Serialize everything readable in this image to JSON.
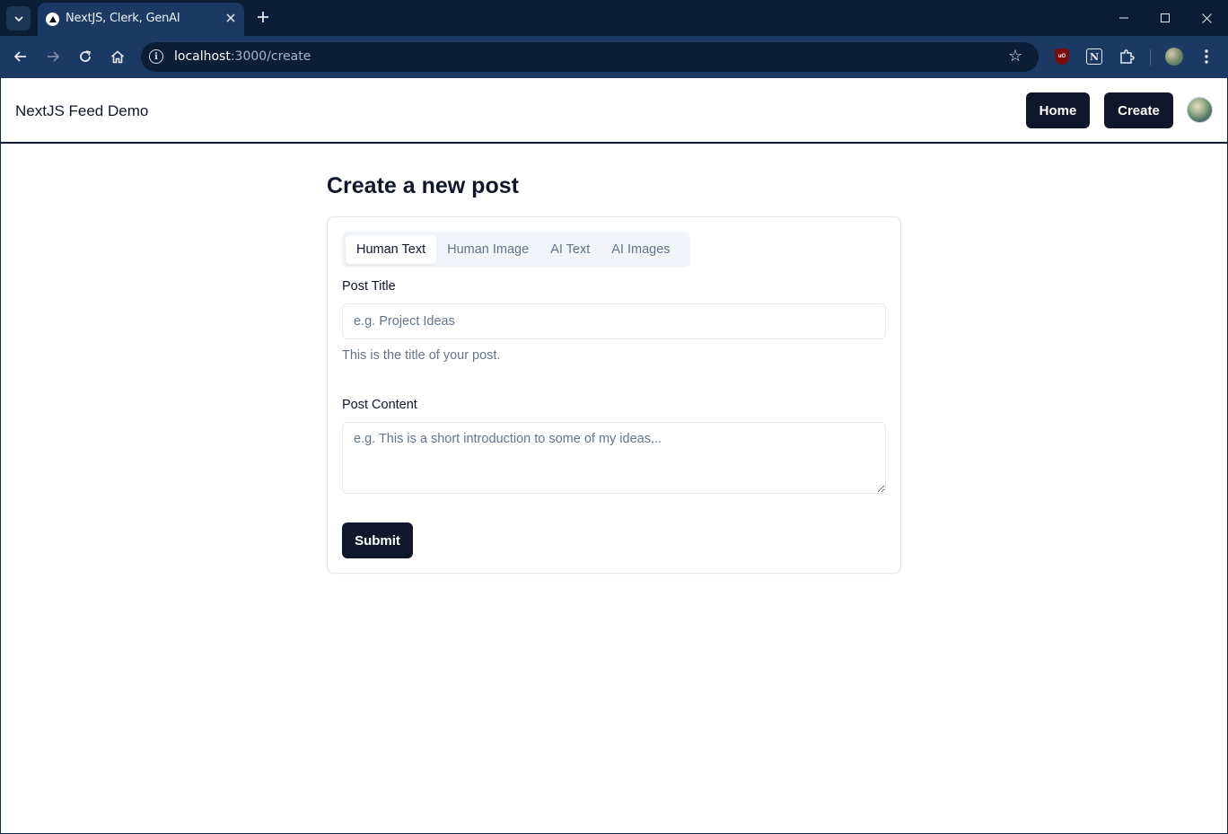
{
  "browser": {
    "tab_title": "NextJS, Clerk, GenAI",
    "url_host": "localhost",
    "url_path": ":3000/create",
    "ext_ublock_label": "uO"
  },
  "navbar": {
    "brand": "NextJS Feed Demo",
    "home_label": "Home",
    "create_label": "Create"
  },
  "main": {
    "heading": "Create a new post",
    "tabs": [
      {
        "label": "Human Text",
        "active": true
      },
      {
        "label": "Human Image",
        "active": false
      },
      {
        "label": "AI Text",
        "active": false
      },
      {
        "label": "AI Images",
        "active": false
      }
    ],
    "form": {
      "title_label": "Post Title",
      "title_placeholder": "e.g. Project Ideas",
      "title_value": "",
      "title_description": "This is the title of your post.",
      "content_label": "Post Content",
      "content_placeholder": "e.g. This is a short introduction to some of my ideas...",
      "content_value": "",
      "submit_label": "Submit"
    }
  },
  "colors": {
    "primary": "#0f172a",
    "muted_text": "#64748b",
    "border": "#e2e8f0",
    "tabs_bg": "#f1f5f9",
    "chrome_dark": "#0a1c36",
    "chrome_toolbar": "#1b3a63"
  },
  "icons": {
    "tab_search": "chevron-down-icon",
    "favicon": "nextjs-triangle-icon",
    "tab_close": "close-icon",
    "new_tab": "plus-icon",
    "back": "arrow-left-icon",
    "forward": "arrow-right-icon",
    "reload": "reload-icon",
    "home": "home-icon",
    "site_info": "info-icon",
    "bookmark": "star-icon",
    "extensions": "puzzle-icon",
    "menu": "kebab-menu-icon"
  }
}
